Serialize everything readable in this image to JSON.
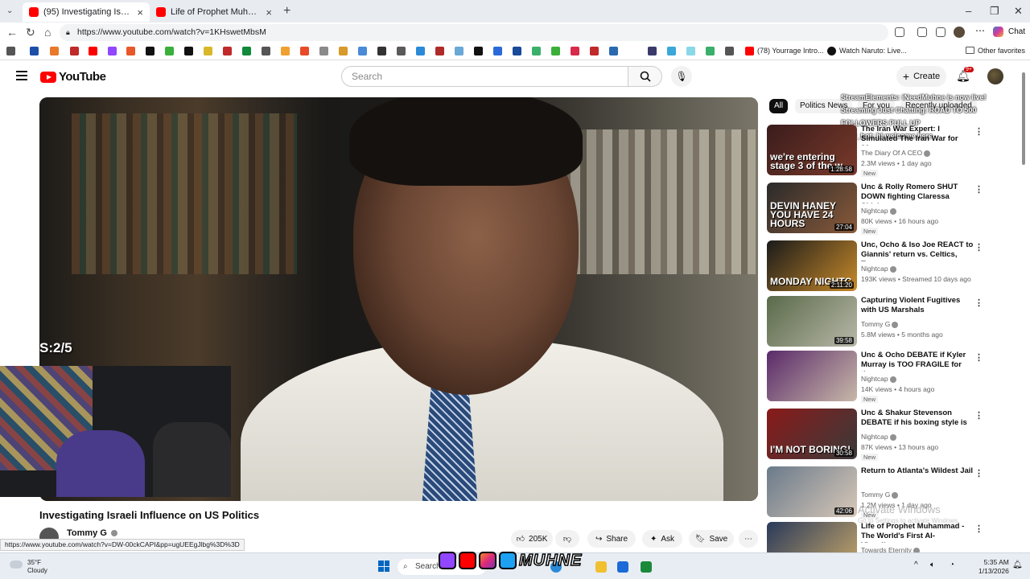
{
  "browser": {
    "tabs": [
      {
        "title": "(95) Investigating Israeli Influe",
        "active": true
      },
      {
        "title": "Life of Prophet Muhammad - The",
        "active": false
      }
    ],
    "url": "https://www.youtube.com/watch?v=1KHswetMbsM",
    "bookmarks": {
      "yourrage": "(78) Yourrage Intro...",
      "naruto": "Watch Naruto: Live...",
      "other": "Other favorites"
    },
    "chat_label": "Chat"
  },
  "youtube": {
    "logo_text": "YouTube",
    "search_placeholder": "Search",
    "create_label": "Create",
    "notif_count": "9+"
  },
  "video": {
    "overlay_text": "S:2/5",
    "title": "Investigating Israeli Influence on US Politics",
    "channel": "Tommy G",
    "likes": "205K",
    "share_label": "Share",
    "ask_label": "Ask",
    "save_label": "Save",
    "status_url": "https://www.youtube.com/watch?v=DW-00ckCAPI&pp=ugUEEgJlbg%3D%3D"
  },
  "sidebar": {
    "chips": [
      "All",
      "Politics News",
      "For you",
      "Recently uploaded"
    ],
    "stream_popup": [
      "StreamElements: iNeedMuhne is now live!",
      "Streaming Just Chatting: ROAD TO 500",
      "FOLLOWERS PULL UP",
      "Sery_bot: hi welcome here"
    ],
    "recommendations": [
      {
        "title": "The Iran War Expert: I Simulated The Iran War for 20...",
        "channel": "The Diary Of A CEO",
        "meta": "2.3M views • 1 day ago",
        "new": "New",
        "duration": "1:28:58",
        "thumb_text": "we're entering stage 3 of the w",
        "colors": [
          "#3a1c1c",
          "#7a3a2a"
        ]
      },
      {
        "title": "Unc & Rolly Romero SHUT DOWN fighting Claressa Shiel...",
        "channel": "Nightcap",
        "meta": "80K views • 16 hours ago",
        "new": "New",
        "duration": "27:04",
        "thumb_text": "DEVIN HANEY YOU HAVE 24 HOURS",
        "colors": [
          "#2a2a2a",
          "#8a5a3a"
        ]
      },
      {
        "title": "Unc, Ocho & Iso Joe REACT to Giannis' return vs. Celtics, Tra...",
        "channel": "Nightcap",
        "meta": "193K views • Streamed 10 days ago",
        "new": "",
        "duration": "2:11:20",
        "thumb_text": "MONDAY NIGHTC",
        "colors": [
          "#1a1a1a",
          "#c88a2a"
        ]
      },
      {
        "title": "Capturing Violent Fugitives with US Marshals",
        "channel": "Tommy G",
        "meta": "5.8M views • 5 months ago",
        "new": "",
        "duration": "39:58",
        "thumb_text": "",
        "colors": [
          "#5a6a4a",
          "#b8b8a8"
        ]
      },
      {
        "title": "Unc & Ocho DEBATE if Kyler Murray is TOO FRAGILE for th...",
        "channel": "Nightcap",
        "meta": "14K views • 4 hours ago",
        "new": "New",
        "duration": "",
        "thumb_text": "",
        "colors": [
          "#5a2a6a",
          "#c8b8a8"
        ]
      },
      {
        "title": "Unc & Shakur Stevenson DEBATE if his boxing style is ...",
        "channel": "Nightcap",
        "meta": "87K views • 13 hours ago",
        "new": "New",
        "duration": "30:58",
        "thumb_text": "I'M NOT BORING!",
        "colors": [
          "#8a1a1a",
          "#3a3a3a"
        ]
      },
      {
        "title": "Return to Atlanta's Wildest Jail",
        "channel": "Tommy G",
        "meta": "1.2M views • 1 day ago",
        "new": "New",
        "duration": "42:06",
        "thumb_text": "",
        "colors": [
          "#6a7a8a",
          "#d8c8b8"
        ]
      },
      {
        "title": "Life of Prophet Muhammad - The World's First AI-Visualize...",
        "channel": "Towards Eternity",
        "meta": "",
        "new": "",
        "duration": "",
        "thumb_text": "O MESSENGER",
        "colors": [
          "#2a3a5a",
          "#c8a86a"
        ]
      }
    ]
  },
  "windows": {
    "activate_title": "Activate Windows",
    "activate_sub": "Go to Settings to activate Windows.",
    "weather_temp": "35°F",
    "weather_desc": "Cloudy",
    "taskbar_search": "Search",
    "streamer_name": "MUHNE",
    "time": "5:35 AM",
    "date": "1/13/2026"
  },
  "colors": {
    "yt_red": "#ff0000",
    "accent_blue": "#065fd4"
  }
}
